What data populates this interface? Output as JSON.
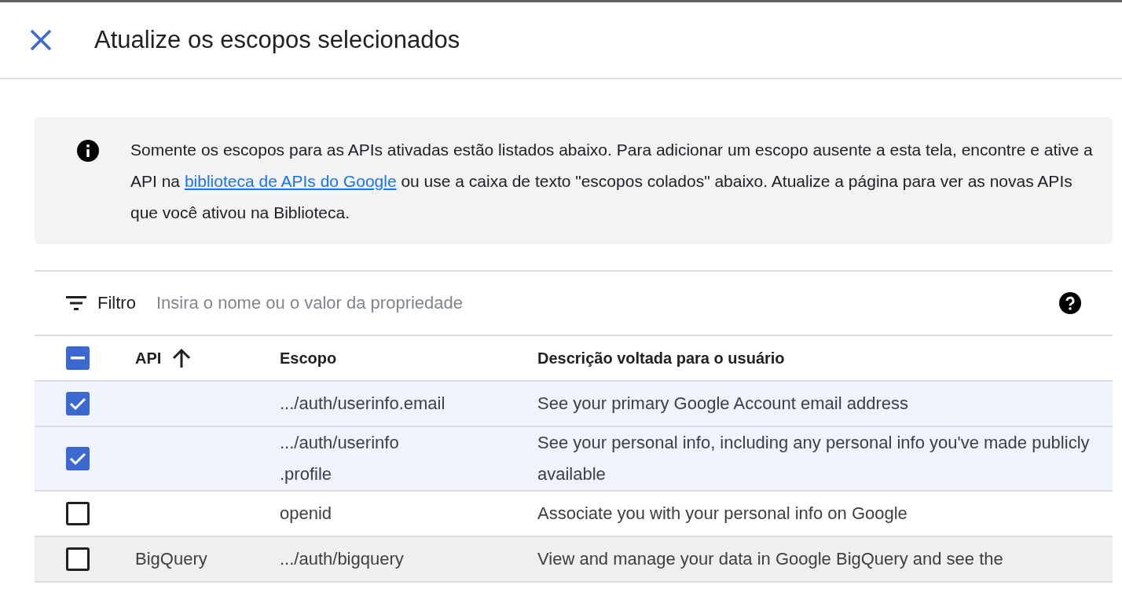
{
  "dialog": {
    "title": "Atualize os escopos selecionados"
  },
  "notice": {
    "text_before": "Somente os escopos para as APIs ativadas estão listados abaixo. Para adicionar um escopo ausente a esta tela, encontre e ative a API na ",
    "link": "biblioteca de APIs do Google",
    "text_after": " ou use a caixa de texto \"escopos colados\" abaixo. Atualize a página para ver as novas APIs que você ativou na Biblioteca."
  },
  "filter": {
    "label": "Filtro",
    "placeholder": "Insira o nome ou o valor da propriedade"
  },
  "table": {
    "select_all": {
      "indeterminate": true
    },
    "columns": [
      {
        "label": "API",
        "sorted": true
      },
      {
        "label": "Escopo",
        "sorted": false
      },
      {
        "label": "Descrição voltada para o usuário",
        "sorted": false
      }
    ],
    "rows": [
      {
        "selected": true,
        "hovered": false,
        "scope": ".../auth/userinfo.email",
        "description": "See your primary Google Account email address"
      },
      {
        "selected": true,
        "hovered": false,
        "scope": ".../auth/userinfo\n.profile",
        "description": "See your personal info, including any personal info you've made publicly available"
      },
      {
        "selected": false,
        "hovered": false,
        "scope": "openid",
        "description": "Associate you with your personal info on Google"
      },
      {
        "selected": false,
        "hovered": true,
        "api": "BigQuery",
        "scope": ".../auth/bigquery",
        "description": "View and manage your data in Google BigQuery and see the"
      }
    ]
  }
}
